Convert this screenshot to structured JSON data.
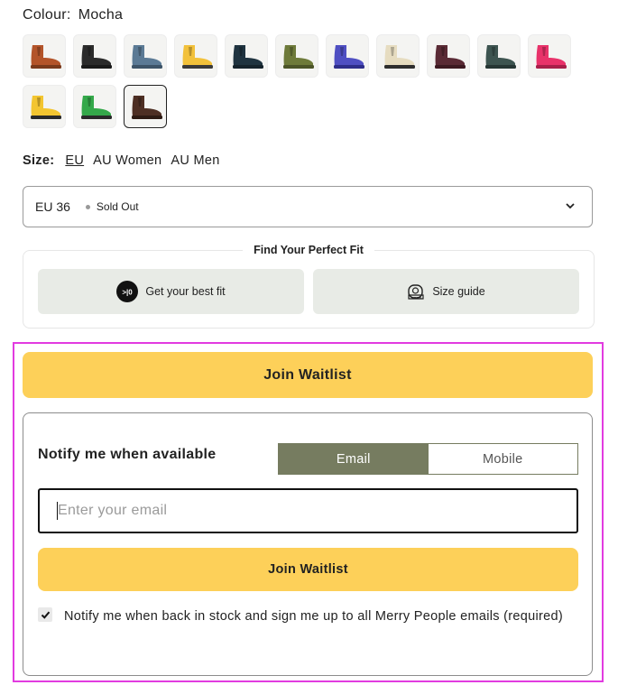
{
  "colour": {
    "label": "Colour:",
    "value": "Mocha"
  },
  "swatches": [
    {
      "name": "swatch-1",
      "color": "#b3542a",
      "sole": "#7a3a1c",
      "selected": false
    },
    {
      "name": "swatch-2",
      "color": "#2b2b2b",
      "sole": "#1a1a1a",
      "selected": false
    },
    {
      "name": "swatch-3",
      "color": "#5b7a95",
      "sole": "#3d5468",
      "selected": false
    },
    {
      "name": "swatch-4",
      "color": "#f2c13b",
      "sole": "#3a3a3a",
      "selected": false
    },
    {
      "name": "swatch-5",
      "color": "#1f3340",
      "sole": "#15232c",
      "selected": false
    },
    {
      "name": "swatch-6",
      "color": "#6e7a3a",
      "sole": "#4c5428",
      "selected": false
    },
    {
      "name": "swatch-7",
      "color": "#4f4fc2",
      "sole": "#2e2e8a",
      "selected": false
    },
    {
      "name": "swatch-8",
      "color": "#e6dcc0",
      "sole": "#2e2e2e",
      "selected": false
    },
    {
      "name": "swatch-9",
      "color": "#5a2a35",
      "sole": "#3d1a22",
      "selected": false
    },
    {
      "name": "swatch-10",
      "color": "#3d5450",
      "sole": "#263634",
      "selected": false
    },
    {
      "name": "swatch-11",
      "color": "#e8326a",
      "sole": "#a81f4a",
      "selected": false
    },
    {
      "name": "swatch-12",
      "color": "#f3c530",
      "sole": "#2a2a2a",
      "selected": false
    },
    {
      "name": "swatch-13",
      "color": "#34a84a",
      "sole": "#2a2a2a",
      "selected": false
    },
    {
      "name": "swatch-14",
      "color": "#4e2f24",
      "sole": "#2e1b14",
      "selected": true
    }
  ],
  "size": {
    "label": "Size:",
    "options": [
      {
        "label": "EU",
        "active": true
      },
      {
        "label": "AU Women",
        "active": false
      },
      {
        "label": "AU Men",
        "active": false
      }
    ],
    "selected": "EU 36",
    "status": "Sold Out"
  },
  "fit": {
    "title": "Find Your Perfect Fit",
    "best_fit_label": "Get your best fit",
    "best_fit_icon": "fit-logo-icon",
    "guide_label": "Size guide",
    "guide_icon": "tape-measure-icon"
  },
  "join_main_label": "Join Waitlist",
  "notify": {
    "title": "Notify me when available",
    "tabs": [
      {
        "label": "Email",
        "active": true
      },
      {
        "label": "Mobile",
        "active": false
      }
    ],
    "email_placeholder": "Enter your email",
    "join_label": "Join Waitlist",
    "consent_checked": true,
    "consent_text": "Notify me when back in stock and sign me up to all Merry People emails (required)"
  },
  "colors": {
    "accent_yellow": "#fdd059",
    "tab_active": "#767c60",
    "highlight": "#e23be0",
    "fit_button_bg": "#e8ebe6"
  }
}
